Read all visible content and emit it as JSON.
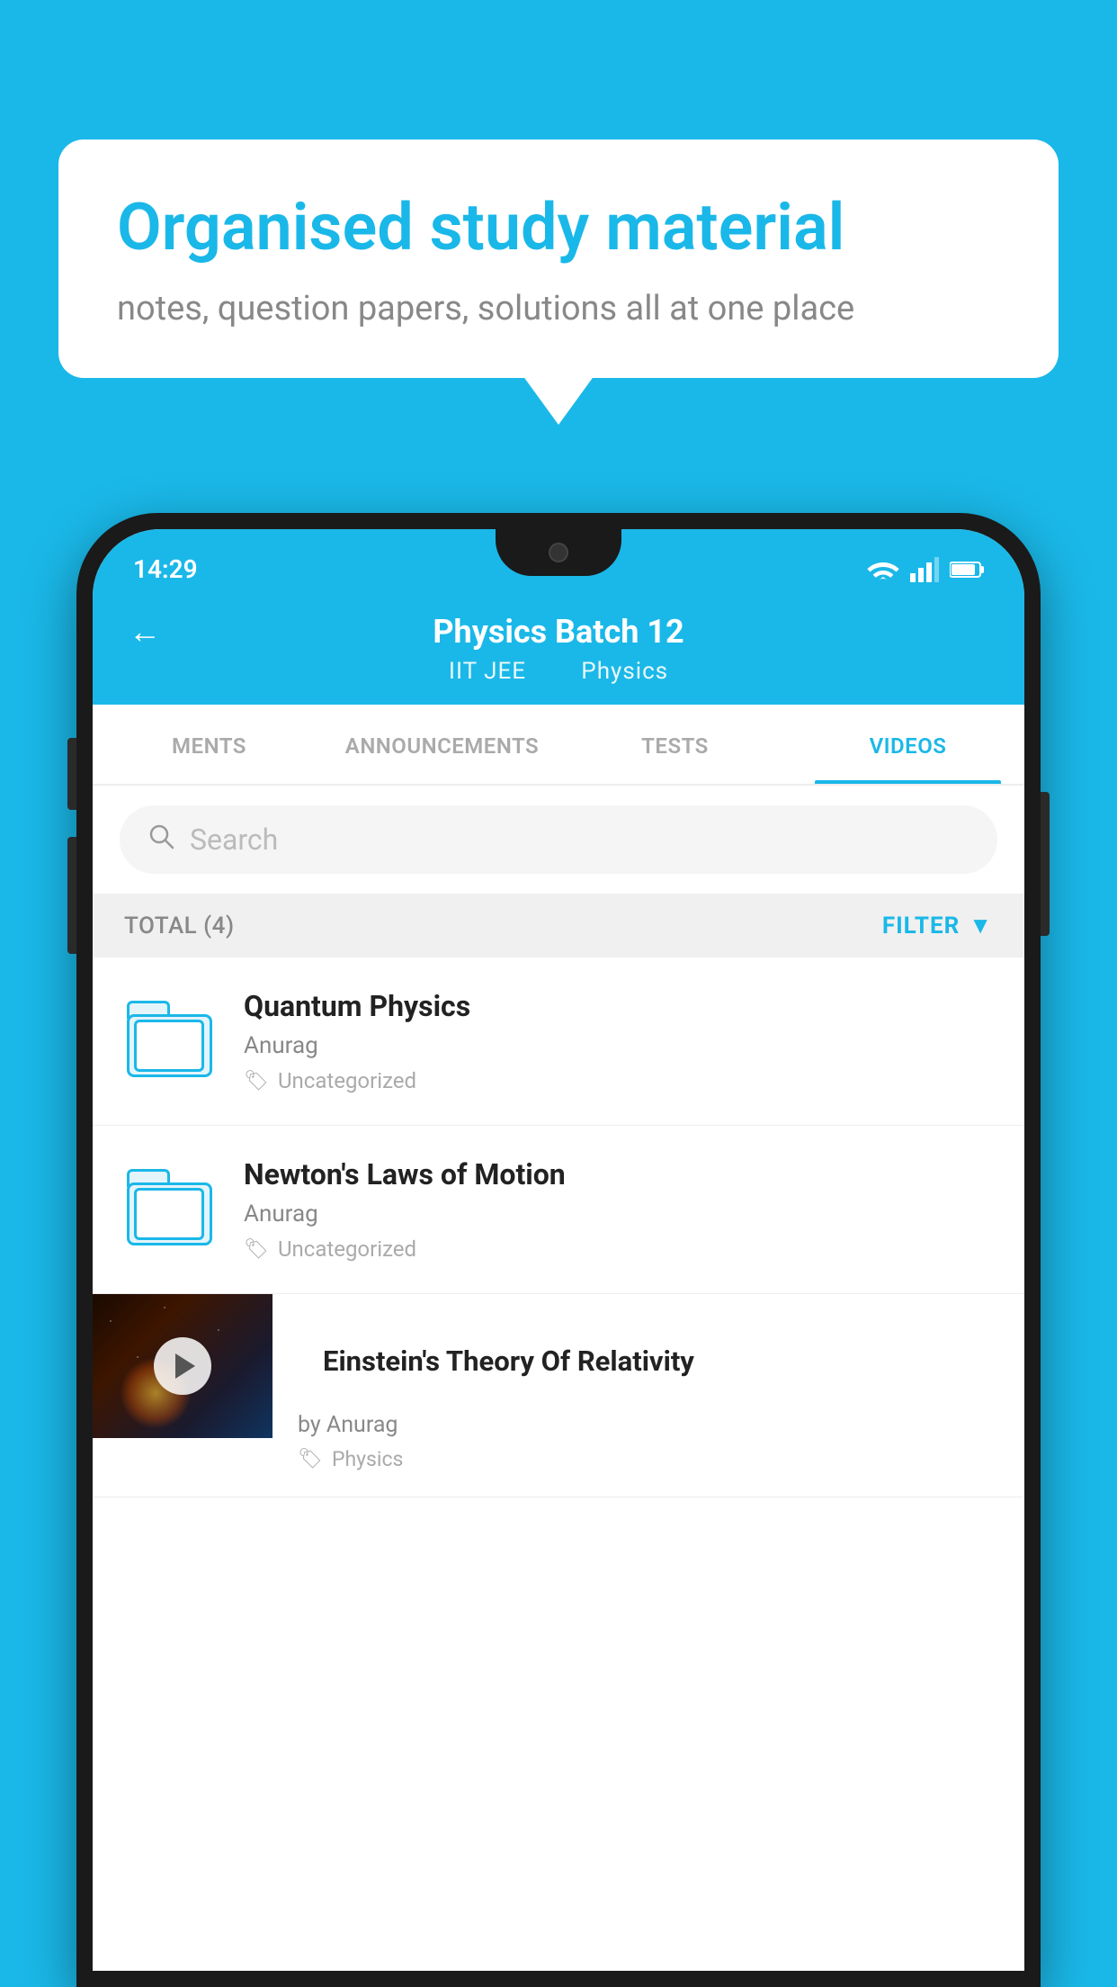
{
  "hero": {
    "title": "Organised study material",
    "subtitle": "notes, question papers, solutions all at one place"
  },
  "statusBar": {
    "time": "14:29",
    "icons": [
      "wifi",
      "signal",
      "battery"
    ]
  },
  "appHeader": {
    "title": "Physics Batch 12",
    "subtitle1": "IIT JEE",
    "subtitle2": "Physics",
    "backLabel": "←"
  },
  "tabs": [
    {
      "label": "MENTS",
      "active": false
    },
    {
      "label": "ANNOUNCEMENTS",
      "active": false
    },
    {
      "label": "TESTS",
      "active": false
    },
    {
      "label": "VIDEOS",
      "active": true
    }
  ],
  "search": {
    "placeholder": "Search"
  },
  "filterBar": {
    "total": "TOTAL (4)",
    "filterLabel": "FILTER"
  },
  "videos": [
    {
      "title": "Quantum Physics",
      "author": "Anurag",
      "tag": "Uncategorized",
      "type": "folder"
    },
    {
      "title": "Newton's Laws of Motion",
      "author": "Anurag",
      "tag": "Uncategorized",
      "type": "folder"
    },
    {
      "title": "Einstein's Theory Of Relativity",
      "author": "by Anurag",
      "tag": "Physics",
      "type": "video"
    }
  ],
  "colors": {
    "primary": "#1AB8E8",
    "textDark": "#222222",
    "textMid": "#888888",
    "textLight": "#aaaaaa"
  }
}
